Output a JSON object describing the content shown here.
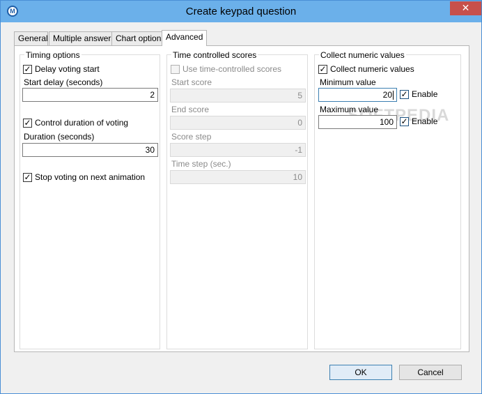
{
  "window": {
    "title": "Create keypad question",
    "icon": "app-icon",
    "close": "close-icon"
  },
  "tabs": [
    {
      "label": "General"
    },
    {
      "label": "Multiple answers"
    },
    {
      "label": "Chart options"
    },
    {
      "label": "Advanced",
      "active": true
    }
  ],
  "timing": {
    "title": "Timing options",
    "delay_start": {
      "label": "Delay voting start",
      "checked": true
    },
    "start_delay_label": "Start delay (seconds)",
    "start_delay_value": "2",
    "control_duration": {
      "label": "Control duration of voting",
      "checked": true
    },
    "duration_label": "Duration (seconds)",
    "duration_value": "30",
    "stop_next": {
      "label": "Stop voting on next animation",
      "checked": true
    }
  },
  "time_scores": {
    "title": "Time controlled scores",
    "use": {
      "label": "Use time-controlled scores",
      "checked": false
    },
    "start_score_label": "Start score",
    "start_score_value": "5",
    "end_score_label": "End score",
    "end_score_value": "0",
    "score_step_label": "Score step",
    "score_step_value": "-1",
    "time_step_label": "Time step (sec.)",
    "time_step_value": "10"
  },
  "numeric": {
    "title": "Collect numeric values",
    "collect": {
      "label": "Collect numeric values",
      "checked": true
    },
    "min_label": "Minimum value",
    "min_value": "20",
    "min_enable": "Enable",
    "max_label": "Maximum value",
    "max_value": "100",
    "max_enable": "Enable"
  },
  "buttons": {
    "ok": "OK",
    "cancel": "Cancel"
  },
  "check_glyph": "✓",
  "watermark": "SOFTPEDIA",
  "colors": {
    "titlebar": "#6bb0ea",
    "close": "#c7504b",
    "check_accent": "#1c5180"
  }
}
